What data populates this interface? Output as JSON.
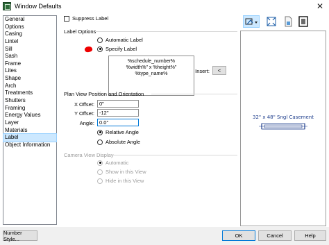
{
  "window": {
    "title": "Window Defaults",
    "close_glyph": "✕"
  },
  "sidebar": {
    "items": [
      {
        "label": "General"
      },
      {
        "label": "Options"
      },
      {
        "label": "Casing"
      },
      {
        "label": "Lintel"
      },
      {
        "label": "Sill"
      },
      {
        "label": "Sash"
      },
      {
        "label": "Frame"
      },
      {
        "label": "Lites"
      },
      {
        "label": "Shape"
      },
      {
        "label": "Arch"
      },
      {
        "label": "Treatments"
      },
      {
        "label": "Shutters"
      },
      {
        "label": "Framing"
      },
      {
        "label": "Energy Values"
      },
      {
        "label": "Layer"
      },
      {
        "label": "Materials"
      },
      {
        "label": "Label",
        "selected": true
      },
      {
        "label": "Object Information"
      }
    ]
  },
  "label_panel": {
    "suppress_label": "Suppress Label",
    "label_options_title": "Label Options",
    "automatic_label": "Automatic Label",
    "specify_label": "Specify Label",
    "label_text_line1": "%schedule_number%",
    "label_text_line2": "%width%\" x %height%\" %type_name%",
    "insert_label": "Insert:",
    "insert_button": "<"
  },
  "plan_view": {
    "title": "Plan View Position and Orientation",
    "x_offset_label": "X Offset:",
    "x_offset_value": "0\"",
    "y_offset_label": "Y Offset:",
    "y_offset_value": "-12\"",
    "angle_label": "Angle:",
    "angle_value": "0.0°",
    "relative_angle": "Relative Angle",
    "absolute_angle": "Absolute Angle"
  },
  "camera_view": {
    "title": "Camera View Display",
    "automatic": "Automatic",
    "show": "Show in this View",
    "hide": "Hide in this View"
  },
  "preview": {
    "label": "32\" x 48\" Sngl Casement"
  },
  "toolbar": {
    "icons": [
      "view-select-icon",
      "fit-view-icon",
      "document-icon",
      "window-elevation-icon"
    ]
  },
  "footer": {
    "number_style": "Number Style...",
    "ok": "OK",
    "cancel": "Cancel",
    "help": "Help"
  },
  "colors": {
    "selection": "#cce8ff",
    "annotation_red": "#e00000",
    "focus": "#0078d7"
  }
}
